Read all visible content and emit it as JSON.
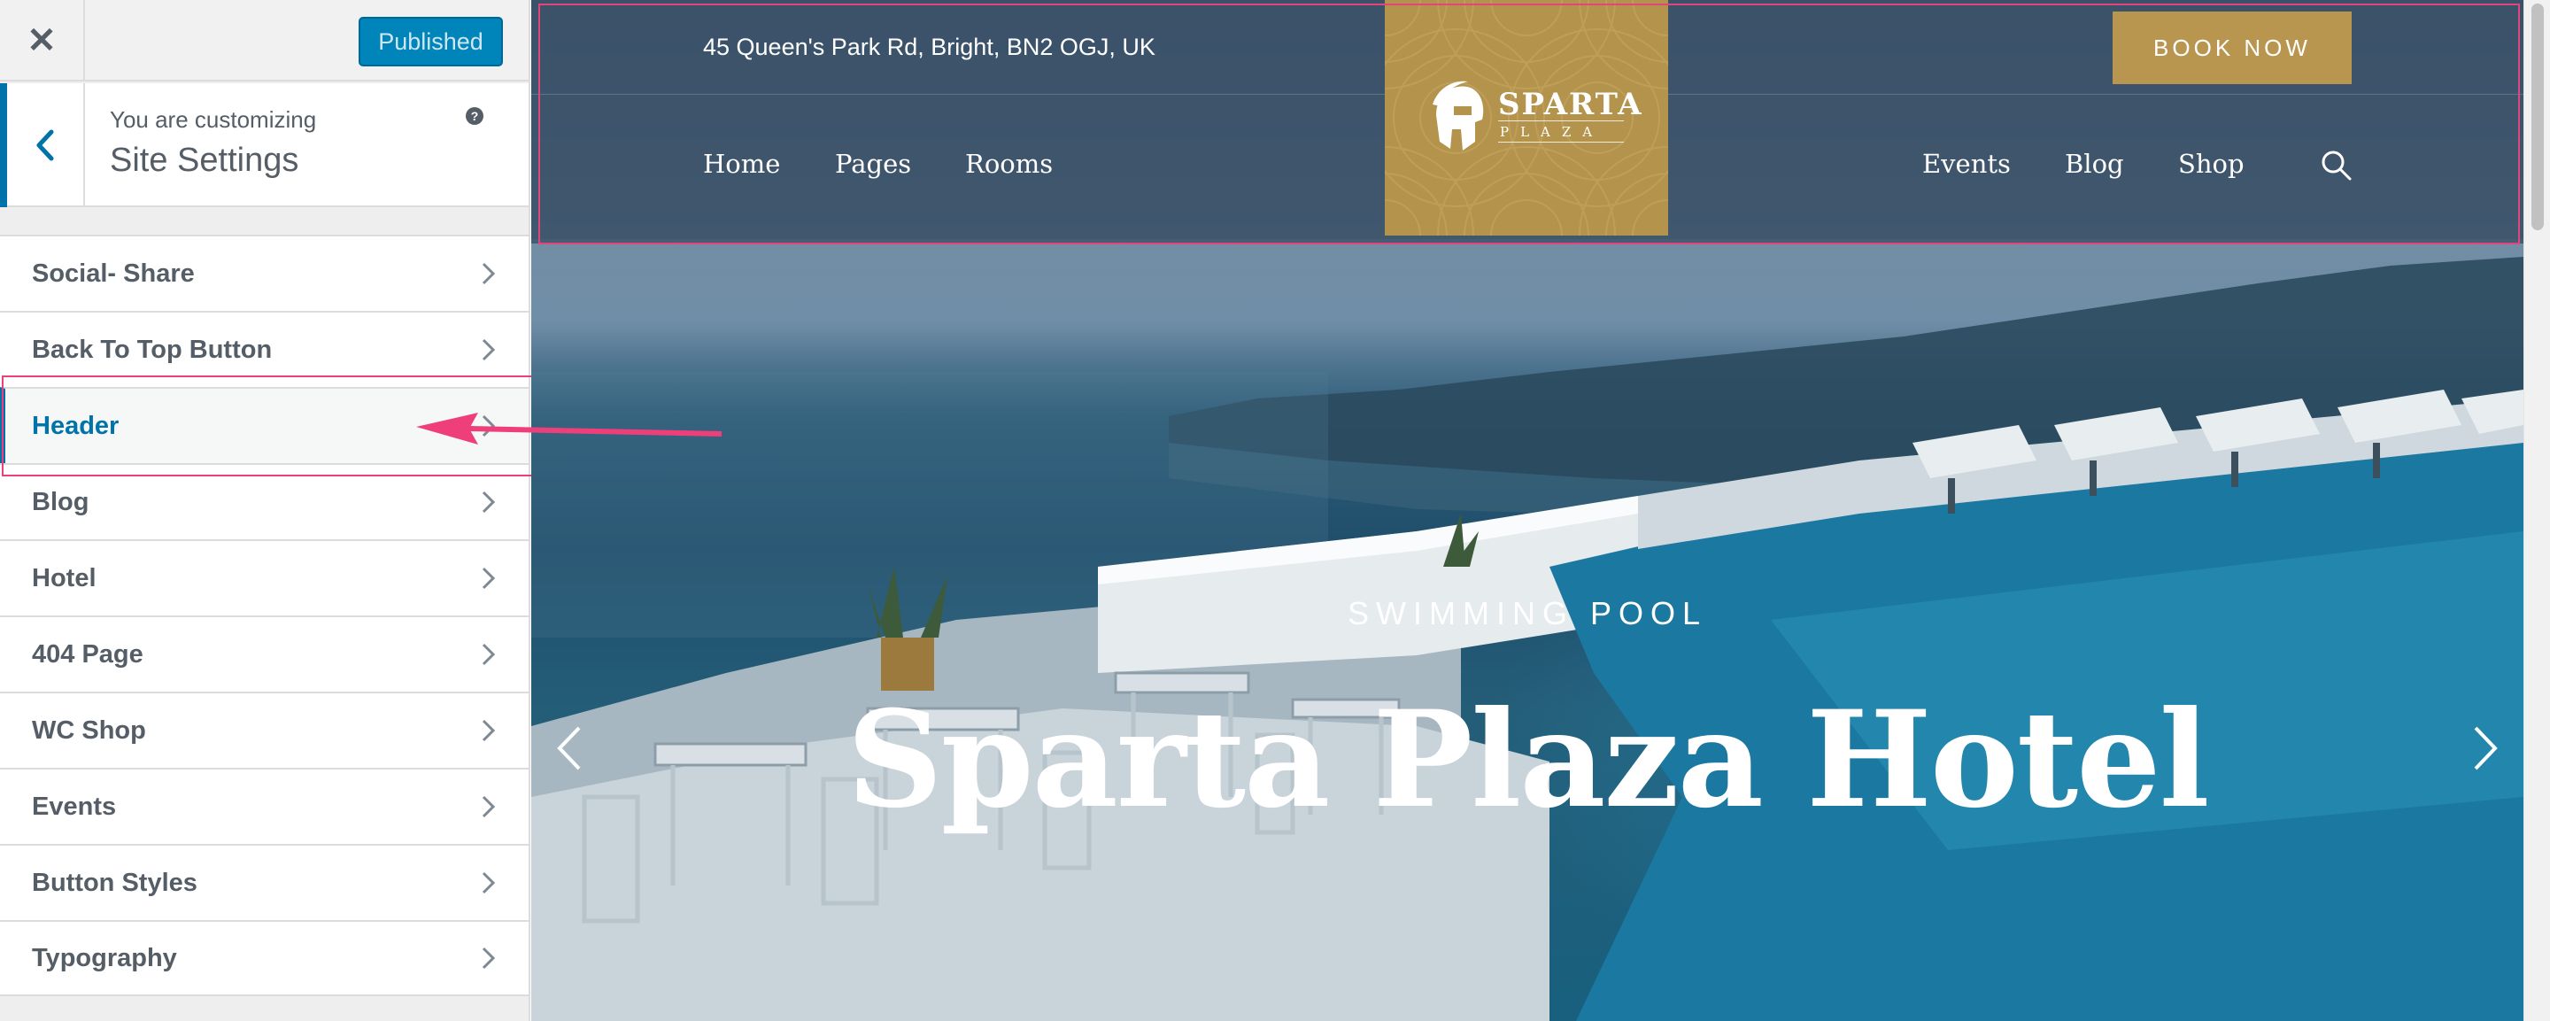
{
  "customizer": {
    "close_icon": "close-icon",
    "publish_label": "Published",
    "customizing_label": "You are customizing",
    "panel_title": "Site Settings",
    "help_icon_glyph": "?",
    "menu_items": [
      {
        "label": "Social- Share"
      },
      {
        "label": "Back To Top Button"
      },
      {
        "label": "Header"
      },
      {
        "label": "Blog"
      },
      {
        "label": "Hotel"
      },
      {
        "label": "404 Page"
      },
      {
        "label": "WC Shop"
      },
      {
        "label": "Events"
      },
      {
        "label": "Button Styles"
      },
      {
        "label": "Typography"
      }
    ],
    "active_item": "Header",
    "accent_color": "#0073aa",
    "highlight_color": "#ee3f7a"
  },
  "preview": {
    "address": "45 Queen's Park Rd, Bright, BN2 OGJ, UK",
    "book_now_label": "BOOK NOW",
    "logo": {
      "name": "SPARTA",
      "sub": "PLAZA"
    },
    "nav_left": [
      "Home",
      "Pages",
      "Rooms"
    ],
    "nav_right": [
      "Events",
      "Blog",
      "Shop"
    ],
    "slide_subtitle": "SWIMMING POOL",
    "slide_title": "Sparta Plaza Hotel",
    "gold_color": "#b4934c"
  }
}
